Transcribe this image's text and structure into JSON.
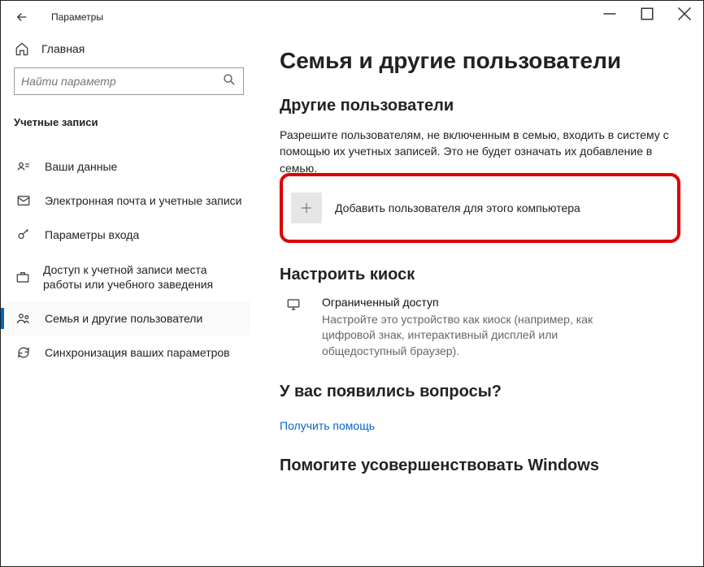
{
  "titlebar": {
    "title": "Параметры"
  },
  "sidebar": {
    "home_label": "Главная",
    "search_placeholder": "Найти параметр",
    "section_label": "Учетные записи",
    "items": [
      {
        "label": "Ваши данные"
      },
      {
        "label": "Электронная почта и учетные записи"
      },
      {
        "label": "Параметры входа"
      },
      {
        "label": "Доступ к учетной записи места работы или учебного заведения"
      },
      {
        "label": "Семья и другие пользователи"
      },
      {
        "label": "Синхронизация ваших параметров"
      }
    ]
  },
  "main": {
    "page_title": "Семья и другие пользователи",
    "other_users_heading": "Другие пользователи",
    "other_users_desc": "Разрешите пользователям, не включенным в семью, входить в систему с помощью их учетных записей. Это не будет означать их добавление в семью.",
    "add_user_label": "Добавить пользователя для этого компьютера",
    "kiosk_heading": "Настроить киоск",
    "kiosk_title": "Ограниченный доступ",
    "kiosk_desc": "Настройте это устройство как киоск (например, как цифровой знак, интерактивный дисплей или общедоступный браузер).",
    "questions_heading": "У вас появились вопросы?",
    "get_help_link": "Получить помощь",
    "improve_heading": "Помогите усовершенствовать Windows"
  }
}
